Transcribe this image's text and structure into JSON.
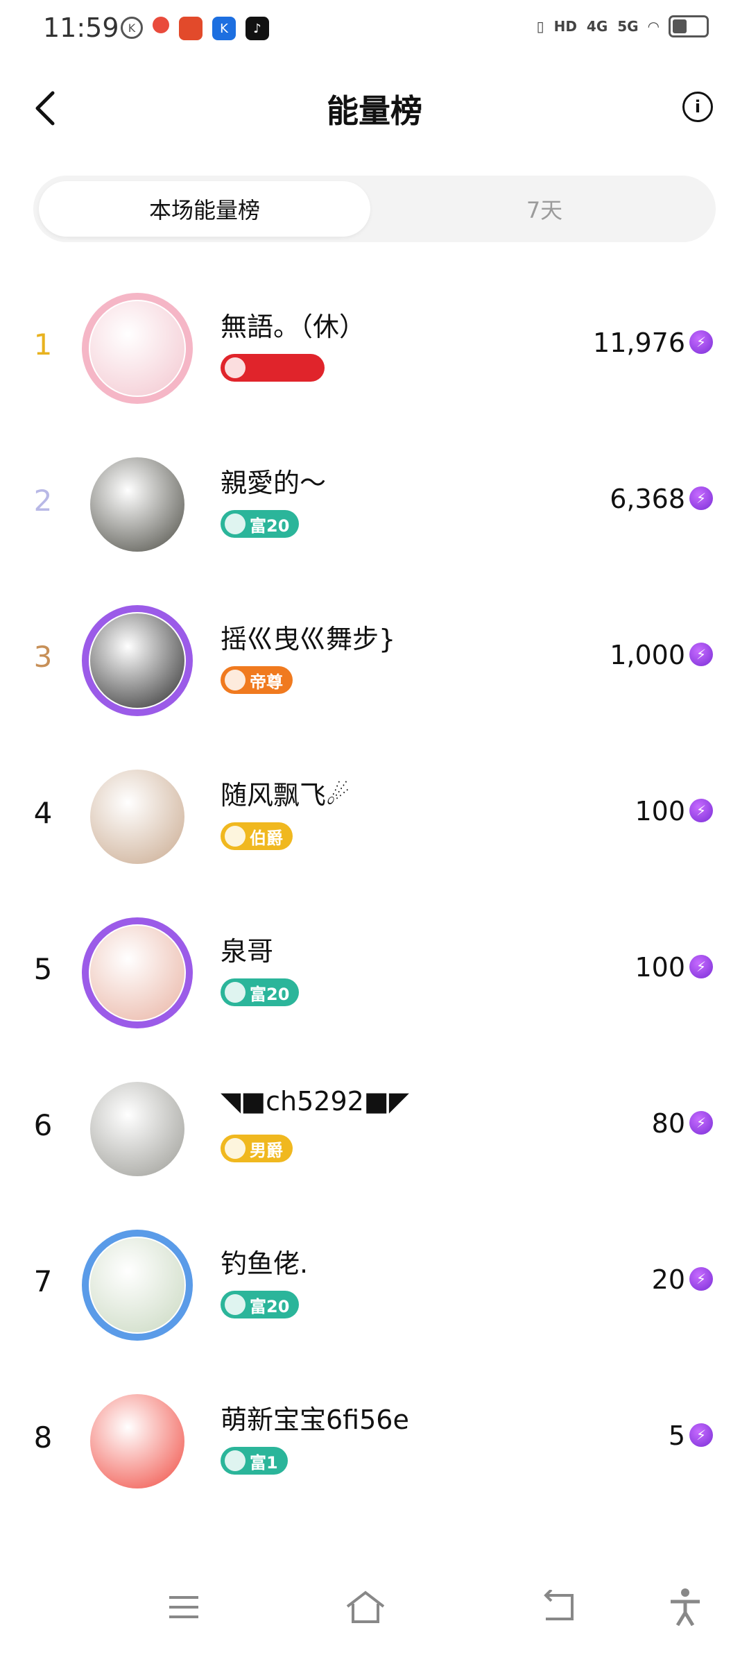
{
  "status_bar": {
    "time": "11:59",
    "network_labels": [
      "HD",
      "4G",
      "5G"
    ],
    "battery_level_percent": 40
  },
  "header": {
    "title": "能量榜",
    "back_icon": "chevron-left-icon",
    "info_icon": "info-icon",
    "info_glyph": "i"
  },
  "tabs": [
    {
      "label": "本场能量榜",
      "active": true
    },
    {
      "label": "7天",
      "active": false
    }
  ],
  "ranking": [
    {
      "rank": "1",
      "name": "無語。（休）",
      "badge": "",
      "badge_color": "#e0242b",
      "score": "11,976",
      "rank_color": "#e8b21f",
      "avatar_color": "#f3c6cf",
      "frame": "pink"
    },
    {
      "rank": "2",
      "name": "親愛的～",
      "badge": "富20",
      "badge_color": "#2bb59a",
      "score": "6,368",
      "rank_color": "#b8b8e6",
      "avatar_color": "#4a4a42",
      "frame": "none"
    },
    {
      "rank": "3",
      "name": "摇巛曳巛舞步}",
      "badge": "帝尊",
      "badge_color": "#f07a1f",
      "score": "1,000",
      "rank_color": "#c79058",
      "avatar_color": "#2b2b2b",
      "frame": "purple"
    },
    {
      "rank": "4",
      "name": "随风飘飞☄",
      "badge": "伯爵",
      "badge_color": "#f0b81f",
      "score": "100",
      "rank_color": "#111111",
      "avatar_color": "#c9a98e",
      "frame": "none"
    },
    {
      "rank": "5",
      "name": "泉哥",
      "badge": "富20",
      "badge_color": "#2bb59a",
      "score": "100",
      "rank_color": "#111111",
      "avatar_color": "#e9b3a3",
      "frame": "purple"
    },
    {
      "rank": "6",
      "name": "◥■ch5292■◤",
      "badge": "男爵",
      "badge_color": "#f0b81f",
      "score": "80",
      "rank_color": "#111111",
      "avatar_color": "#9a9a94",
      "frame": "none"
    },
    {
      "rank": "7",
      "name": "钓鱼佬.",
      "badge": "富20",
      "badge_color": "#2bb59a",
      "score": "20",
      "rank_color": "#111111",
      "avatar_color": "#c9d8c0",
      "frame": "blue"
    },
    {
      "rank": "8",
      "name": "萌新宝宝6fi56e",
      "badge": "富1",
      "badge_color": "#2bb59a",
      "score": "5",
      "rank_color": "#111111",
      "avatar_color": "#f04a40",
      "frame": "none"
    }
  ],
  "score_icon": "energy-bolt-icon",
  "score_glyph": "⚡",
  "nav": [
    "menu-icon",
    "home-icon",
    "back-icon",
    "accessibility-icon"
  ]
}
